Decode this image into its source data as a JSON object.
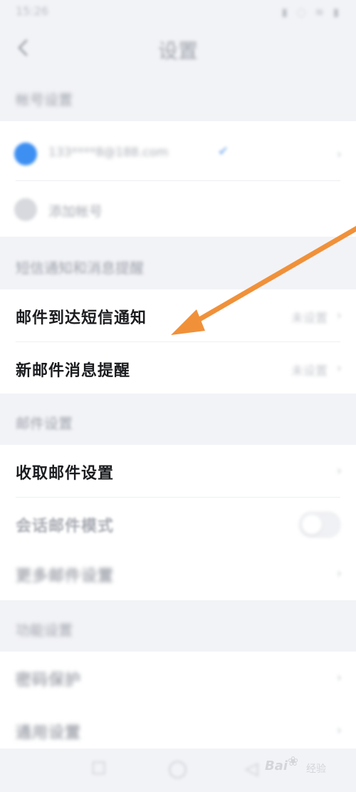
{
  "status_bar": {
    "time": "15:26",
    "icons": "▮ ◌ ≋ ▮"
  },
  "nav": {
    "title": "设置"
  },
  "sections": {
    "account": {
      "header": "帐号设置",
      "email": "133****8@188.com",
      "add_account": "添加帐号"
    },
    "notify": {
      "header": "短信通知和消息提醒",
      "sms_label": "邮件到达短信通知",
      "sms_value": "未设置",
      "push_label": "新邮件消息提醒",
      "push_value": "未设置"
    },
    "mail": {
      "header": "邮件设置",
      "receive_label": "收取邮件设置",
      "conversation_label": "会话邮件模式",
      "more_label": "更多邮件设置"
    },
    "other": {
      "header": "功能设置",
      "item1_label": "密码保护",
      "item2_label": "通用设置"
    }
  },
  "bottom_nav": {
    "icons": [
      "menu-icon",
      "home-icon",
      "back-icon"
    ]
  },
  "watermark": {
    "text": "Bai",
    "suffix": "经验"
  },
  "colors": {
    "arrow": "#f0913a",
    "accent": "#3d8ff2",
    "background": "#f2f3f7"
  }
}
